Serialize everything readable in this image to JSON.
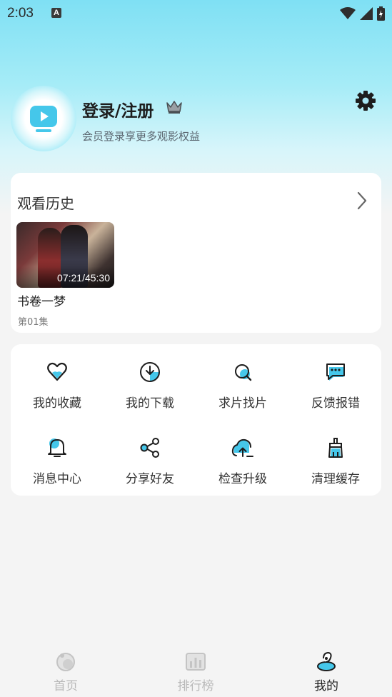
{
  "status_bar": {
    "time": "2:03",
    "notification_icon": "A"
  },
  "profile": {
    "title": "登录/注册",
    "subtitle": "会员登录享更多观影权益"
  },
  "history": {
    "title": "观看历史",
    "items": [
      {
        "duration": "07:21/45:30",
        "name": "书卷一梦",
        "episode": "第01集"
      }
    ]
  },
  "menu": [
    {
      "label": "我的收藏",
      "icon": "heart-icon"
    },
    {
      "label": "我的下载",
      "icon": "download-icon"
    },
    {
      "label": "求片找片",
      "icon": "search-icon"
    },
    {
      "label": "反馈报错",
      "icon": "feedback-icon"
    },
    {
      "label": "消息中心",
      "icon": "bell-icon"
    },
    {
      "label": "分享好友",
      "icon": "share-icon"
    },
    {
      "label": "检查升级",
      "icon": "upgrade-icon"
    },
    {
      "label": "清理缓存",
      "icon": "broom-icon"
    }
  ],
  "tabs": [
    {
      "label": "首页",
      "active": false
    },
    {
      "label": "排行榜",
      "active": false
    },
    {
      "label": "我的",
      "active": true
    }
  ],
  "colors": {
    "accent": "#45c7ea",
    "header_top": "#7fe0f4",
    "background": "#f4f4f4"
  }
}
